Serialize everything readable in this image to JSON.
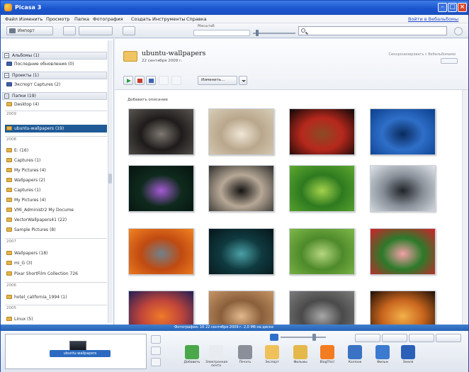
{
  "window": {
    "title": "Picasa 3",
    "controls": [
      "minimize",
      "maximize",
      "close"
    ],
    "title_color": "#1a55cf",
    "status_bar_color": "#2e6fc5",
    "selected_color": "#1f5a96"
  },
  "menu": {
    "items": [
      "Файл",
      "Изменить",
      "Просмотр",
      "Папка",
      "Фотография",
      "Создать",
      "Инструменты",
      "Справка"
    ],
    "sign_in": "Войти в Вебальбомы"
  },
  "toolbar": {
    "import_label": "Импорт",
    "zoom_label": "Масштаб",
    "search_value": ""
  },
  "sidebar": {
    "sections": [
      {
        "label": "Альбомы (1)",
        "expanded": true,
        "items": [
          {
            "label": "Последние обновления (0)",
            "icon": "album-icon"
          }
        ]
      },
      {
        "label": "Проекты (1)",
        "expanded": true,
        "items": [
          {
            "label": "Экспорт Captures (2)",
            "icon": "project-icon"
          }
        ]
      },
      {
        "label": "Папки (19)",
        "expanded": true
      }
    ],
    "folder_groups": [
      {
        "year": "",
        "folders": [
          "Desktop (4)"
        ]
      },
      {
        "year": "2009",
        "folders": [
          "ubuntu-wallpapers (19)"
        ]
      },
      {
        "year": "2008",
        "folders": [
          "E: (16)",
          "Captures (1)",
          "My Pictures (4)",
          "Wallpapers (2)",
          "Captures (1)",
          "My Pictures (4)",
          "VMi_Administr2 My Docume",
          "VectorWallpapers41 (22)",
          "Sample Pictures (8)"
        ]
      },
      {
        "year": "2007",
        "folders": [
          "Wallpapers (18)",
          "mi_G (3)",
          "Pixar ShortFilm Collection 726"
        ]
      },
      {
        "year": "2006",
        "folders": [
          "hotel_california_1994 (1)"
        ]
      },
      {
        "year": "2005",
        "folders": [
          "Linux (5)"
        ]
      }
    ],
    "selected_folder": "ubuntu-wallpapers (19)"
  },
  "content": {
    "folder_name": "ubuntu-wallpapers",
    "folder_date": "22 сентября 2009 г.",
    "folder_actions": "Синхронизировать с Вебальбомами",
    "edit_label": "Изменить…",
    "add_description": "Добавить описание",
    "thumbnails": [
      {
        "name": "thumbnail-dark-waves",
        "colors": [
          "#5a5551",
          "#1e1c1b",
          "#7d7770"
        ]
      },
      {
        "name": "thumbnail-beach-sand",
        "colors": [
          "#d8cdb7",
          "#b9a78c",
          "#efe6d6"
        ]
      },
      {
        "name": "thumbnail-cherries",
        "colors": [
          "#0b0807",
          "#b7281c",
          "#8b4b25"
        ]
      },
      {
        "name": "thumbnail-blue-sky",
        "colors": [
          "#0a3f8c",
          "#2f6fc9",
          "#0a2b5e"
        ]
      },
      {
        "name": "thumbnail-water-lily",
        "colors": [
          "#06140f",
          "#0f2a1d",
          "#a55bd4"
        ]
      },
      {
        "name": "thumbnail-hands",
        "colors": [
          "#2f2e2c",
          "#b7a896",
          "#151413"
        ]
      },
      {
        "name": "thumbnail-green-grass",
        "colors": [
          "#5ea830",
          "#2e7a1f",
          "#a4d24c"
        ]
      },
      {
        "name": "thumbnail-misty-tree",
        "colors": [
          "#dfe5ea",
          "#8a9099",
          "#20242a"
        ]
      },
      {
        "name": "thumbnail-orange-flower",
        "colors": [
          "#f28321",
          "#c04a11",
          "#71808a"
        ]
      },
      {
        "name": "thumbnail-night-water",
        "colors": [
          "#06161a",
          "#0f3a3f",
          "#4aa0a6"
        ]
      },
      {
        "name": "thumbnail-green-leaf",
        "colors": [
          "#7fb84a",
          "#4e8a2a",
          "#b6d680"
        ]
      },
      {
        "name": "thumbnail-red-flowers",
        "colors": [
          "#d3202c",
          "#2c7a29",
          "#f3a0a6"
        ]
      },
      {
        "name": "thumbnail-sunset",
        "colors": [
          "#1f1d57",
          "#c0453a",
          "#f07a28"
        ]
      },
      {
        "name": "thumbnail-sand-dune",
        "colors": [
          "#c69666",
          "#8a5f3b",
          "#e2b98d"
        ]
      },
      {
        "name": "thumbnail-stone",
        "colors": [
          "#7c7c7c",
          "#4a4a4a",
          "#a8a8a8"
        ]
      },
      {
        "name": "thumbnail-light-trails",
        "colors": [
          "#1b0e07",
          "#c9661e",
          "#f3b04a"
        ]
      }
    ]
  },
  "status": {
    "text": "Фотография: 16    22 сентября 2009 г.    2,0 Мб на диске"
  },
  "tray": {
    "selection_label": "ubuntu-wallpapers",
    "actions": [
      {
        "name": "upload-action",
        "label": "Добавить",
        "icon": "upload-icon",
        "color": "#4aa84a"
      },
      {
        "name": "email-action",
        "label": "Электронная почта",
        "icon": "email-icon",
        "color": "#e8ebf0"
      },
      {
        "name": "print-action",
        "label": "Печать",
        "icon": "print-icon",
        "color": "#8a8f99"
      },
      {
        "name": "export-action",
        "label": "Экспорт",
        "icon": "folder-export-icon",
        "color": "#efc15a"
      },
      {
        "name": "movie-action",
        "label": "Фильмы",
        "icon": "movie-icon",
        "color": "#e4b84a"
      },
      {
        "name": "blogger-action",
        "label": "BlogThis!",
        "icon": "blogger-icon",
        "color": "#f47c20"
      },
      {
        "name": "collage-action",
        "label": "Коллаж",
        "icon": "collage-icon",
        "color": "#3a72c4"
      },
      {
        "name": "movie2-action",
        "label": "Фильм",
        "icon": "film-icon",
        "color": "#3c7bd0"
      },
      {
        "name": "geotag-action",
        "label": "Земля",
        "icon": "earth-icon",
        "color": "#2b5fb8"
      }
    ]
  }
}
